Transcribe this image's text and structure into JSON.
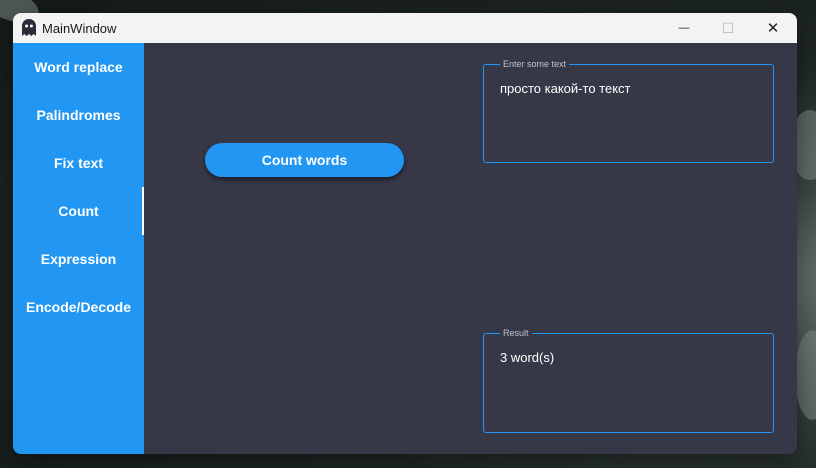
{
  "window": {
    "title": "MainWindow",
    "controls": {
      "minimize": "—",
      "maximize": "☐",
      "close": "✕"
    }
  },
  "sidebar": {
    "items": [
      {
        "label": "Word replace",
        "active": false
      },
      {
        "label": "Palindromes",
        "active": false
      },
      {
        "label": "Fix text",
        "active": false
      },
      {
        "label": "Count",
        "active": true
      },
      {
        "label": "Expression",
        "active": false
      },
      {
        "label": "Encode/Decode",
        "active": false
      }
    ]
  },
  "main": {
    "action_button": "Count words",
    "input": {
      "label": "Enter some text",
      "value": "просто какой-то текст"
    },
    "result": {
      "label": "Result",
      "value": "3 word(s)"
    }
  },
  "colors": {
    "accent": "#2196f3",
    "panel": "#363847",
    "titlebar": "#f3f3f3"
  },
  "icons": [
    "ghost-icon",
    "minimize-icon",
    "maximize-icon",
    "close-icon"
  ]
}
